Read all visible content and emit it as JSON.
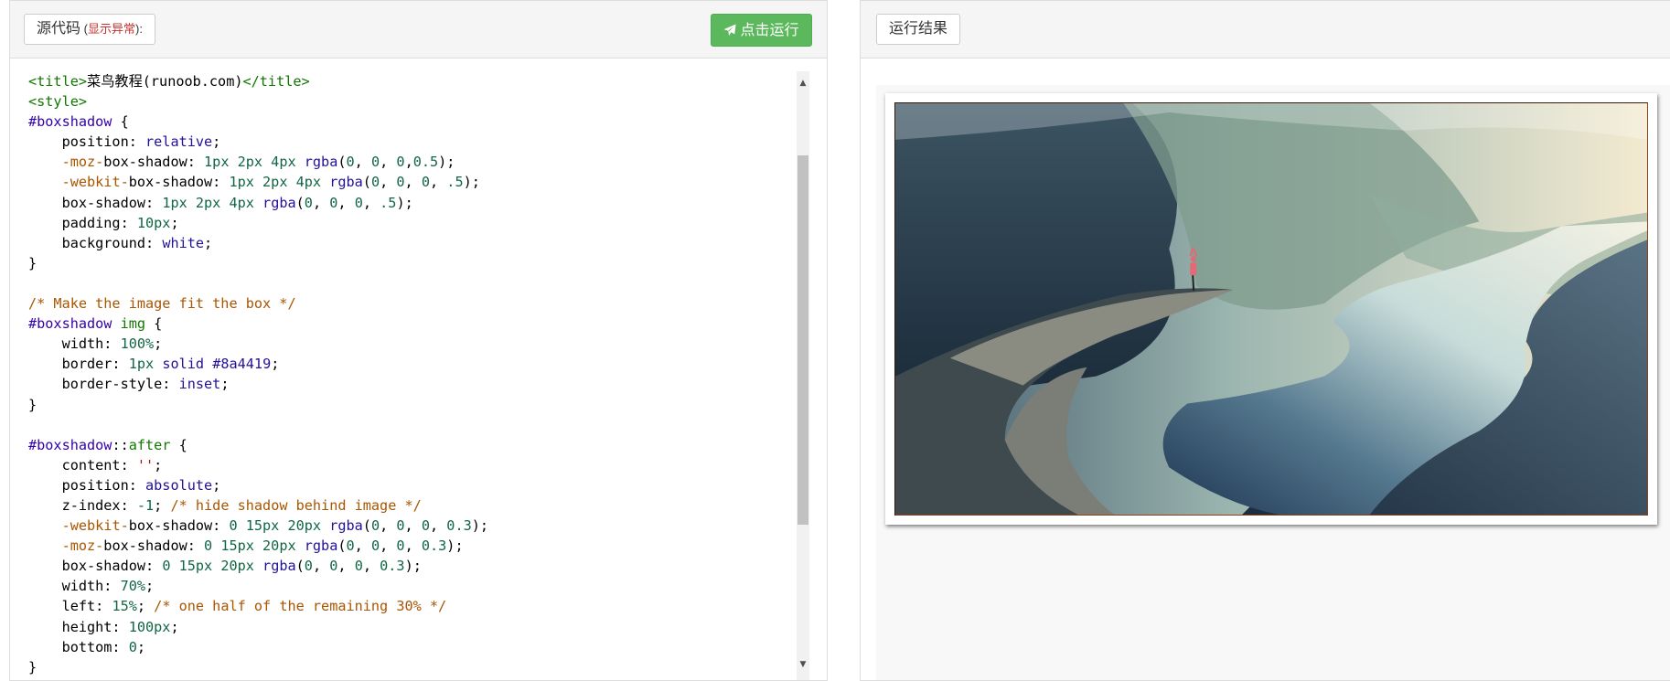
{
  "source_panel": {
    "label": "源代码",
    "label_suffix_open": " (",
    "label_warning": "显示异常",
    "label_suffix_close": "):"
  },
  "run_button": {
    "label": "点击运行"
  },
  "result_panel": {
    "label": "运行结果"
  },
  "code_lines": [
    [
      [
        "tg",
        "<title>"
      ],
      [
        "tx",
        "菜鸟教程(runoob.com)"
      ],
      [
        "tg",
        "</title>"
      ]
    ],
    [
      [
        "tg",
        "<style>"
      ]
    ],
    [
      [
        "sel",
        "#boxshadow"
      ],
      [
        "tx",
        " {"
      ]
    ],
    [
      [
        "tx",
        "    position: "
      ],
      [
        "kw",
        "relative"
      ],
      [
        "tx",
        ";"
      ]
    ],
    [
      [
        "tx",
        "    "
      ],
      [
        "cm",
        "-moz-"
      ],
      [
        "tx",
        "box-shadow: "
      ],
      [
        "num",
        "1px 2px 4px "
      ],
      [
        "kw",
        "rgba"
      ],
      [
        "tx",
        "("
      ],
      [
        "num",
        "0"
      ],
      [
        "tx",
        ", "
      ],
      [
        "num",
        "0"
      ],
      [
        "tx",
        ", "
      ],
      [
        "num",
        "0"
      ],
      [
        "tx",
        ","
      ],
      [
        "num",
        "0.5"
      ],
      [
        "tx",
        ");"
      ]
    ],
    [
      [
        "tx",
        "    "
      ],
      [
        "cm",
        "-webkit-"
      ],
      [
        "tx",
        "box-shadow: "
      ],
      [
        "num",
        "1px 2px 4px "
      ],
      [
        "kw",
        "rgba"
      ],
      [
        "tx",
        "("
      ],
      [
        "num",
        "0"
      ],
      [
        "tx",
        ", "
      ],
      [
        "num",
        "0"
      ],
      [
        "tx",
        ", "
      ],
      [
        "num",
        "0"
      ],
      [
        "tx",
        ", "
      ],
      [
        "num",
        ".5"
      ],
      [
        "tx",
        ");"
      ]
    ],
    [
      [
        "tx",
        "    box-shadow: "
      ],
      [
        "num",
        "1px 2px 4px "
      ],
      [
        "kw",
        "rgba"
      ],
      [
        "tx",
        "("
      ],
      [
        "num",
        "0"
      ],
      [
        "tx",
        ", "
      ],
      [
        "num",
        "0"
      ],
      [
        "tx",
        ", "
      ],
      [
        "num",
        "0"
      ],
      [
        "tx",
        ", "
      ],
      [
        "num",
        ".5"
      ],
      [
        "tx",
        ");"
      ]
    ],
    [
      [
        "tx",
        "    padding: "
      ],
      [
        "num",
        "10px"
      ],
      [
        "tx",
        ";"
      ]
    ],
    [
      [
        "tx",
        "    background: "
      ],
      [
        "kw",
        "white"
      ],
      [
        "tx",
        ";"
      ]
    ],
    [
      [
        "tx",
        "}"
      ]
    ],
    [
      [
        "tx",
        ""
      ]
    ],
    [
      [
        "cm",
        "/* Make the image fit the box */"
      ]
    ],
    [
      [
        "sel",
        "#boxshadow"
      ],
      [
        "tx",
        " "
      ],
      [
        "tg",
        "img"
      ],
      [
        "tx",
        " {"
      ]
    ],
    [
      [
        "tx",
        "    width: "
      ],
      [
        "num",
        "100%"
      ],
      [
        "tx",
        ";"
      ]
    ],
    [
      [
        "tx",
        "    border: "
      ],
      [
        "num",
        "1px"
      ],
      [
        "tx",
        " "
      ],
      [
        "kw",
        "solid"
      ],
      [
        "tx",
        " "
      ],
      [
        "kw",
        "#8a4419"
      ],
      [
        "tx",
        ";"
      ]
    ],
    [
      [
        "tx",
        "    border-style: "
      ],
      [
        "kw",
        "inset"
      ],
      [
        "tx",
        ";"
      ]
    ],
    [
      [
        "tx",
        "}"
      ]
    ],
    [
      [
        "tx",
        ""
      ]
    ],
    [
      [
        "sel",
        "#boxshadow"
      ],
      [
        "tx",
        "::"
      ],
      [
        "tg",
        "after"
      ],
      [
        "tx",
        " {"
      ]
    ],
    [
      [
        "tx",
        "    content: "
      ],
      [
        "str",
        "''"
      ],
      [
        "tx",
        ";"
      ]
    ],
    [
      [
        "tx",
        "    position: "
      ],
      [
        "kw",
        "absolute"
      ],
      [
        "tx",
        ";"
      ]
    ],
    [
      [
        "tx",
        "    z-index: "
      ],
      [
        "num",
        "-1"
      ],
      [
        "tx",
        "; "
      ],
      [
        "cm",
        "/* hide shadow behind image */"
      ]
    ],
    [
      [
        "tx",
        "    "
      ],
      [
        "cm",
        "-webkit-"
      ],
      [
        "tx",
        "box-shadow: "
      ],
      [
        "num",
        "0 15px 20px "
      ],
      [
        "kw",
        "rgba"
      ],
      [
        "tx",
        "("
      ],
      [
        "num",
        "0"
      ],
      [
        "tx",
        ", "
      ],
      [
        "num",
        "0"
      ],
      [
        "tx",
        ", "
      ],
      [
        "num",
        "0"
      ],
      [
        "tx",
        ", "
      ],
      [
        "num",
        "0.3"
      ],
      [
        "tx",
        ");"
      ]
    ],
    [
      [
        "tx",
        "    "
      ],
      [
        "cm",
        "-moz-"
      ],
      [
        "tx",
        "box-shadow: "
      ],
      [
        "num",
        "0 15px 20px "
      ],
      [
        "kw",
        "rgba"
      ],
      [
        "tx",
        "("
      ],
      [
        "num",
        "0"
      ],
      [
        "tx",
        ", "
      ],
      [
        "num",
        "0"
      ],
      [
        "tx",
        ", "
      ],
      [
        "num",
        "0"
      ],
      [
        "tx",
        ", "
      ],
      [
        "num",
        "0.3"
      ],
      [
        "tx",
        ");"
      ]
    ],
    [
      [
        "tx",
        "    box-shadow: "
      ],
      [
        "num",
        "0 15px 20px "
      ],
      [
        "kw",
        "rgba"
      ],
      [
        "tx",
        "("
      ],
      [
        "num",
        "0"
      ],
      [
        "tx",
        ", "
      ],
      [
        "num",
        "0"
      ],
      [
        "tx",
        ", "
      ],
      [
        "num",
        "0"
      ],
      [
        "tx",
        ", "
      ],
      [
        "num",
        "0.3"
      ],
      [
        "tx",
        ");"
      ]
    ],
    [
      [
        "tx",
        "    width: "
      ],
      [
        "num",
        "70%"
      ],
      [
        "tx",
        ";"
      ]
    ],
    [
      [
        "tx",
        "    left: "
      ],
      [
        "num",
        "15%"
      ],
      [
        "tx",
        "; "
      ],
      [
        "cm",
        "/* one half of the remaining 30% */"
      ]
    ],
    [
      [
        "tx",
        "    height: "
      ],
      [
        "num",
        "100px"
      ],
      [
        "tx",
        ";"
      ]
    ],
    [
      [
        "tx",
        "    bottom: "
      ],
      [
        "num",
        "0"
      ],
      [
        "tx",
        ";"
      ]
    ],
    [
      [
        "tx",
        "}"
      ]
    ]
  ],
  "colors": {
    "run_button": "#5cb85c",
    "warning_text": "#c9302c",
    "tag": "#117700",
    "selector": "#3300aa",
    "keyword": "#221199",
    "number": "#116644",
    "comment": "#aa5500",
    "image_border": "#8a4419"
  },
  "icons": {
    "run": "paper-plane-icon",
    "scroll_up": "arrow-up-icon",
    "scroll_down": "arrow-down-icon"
  }
}
